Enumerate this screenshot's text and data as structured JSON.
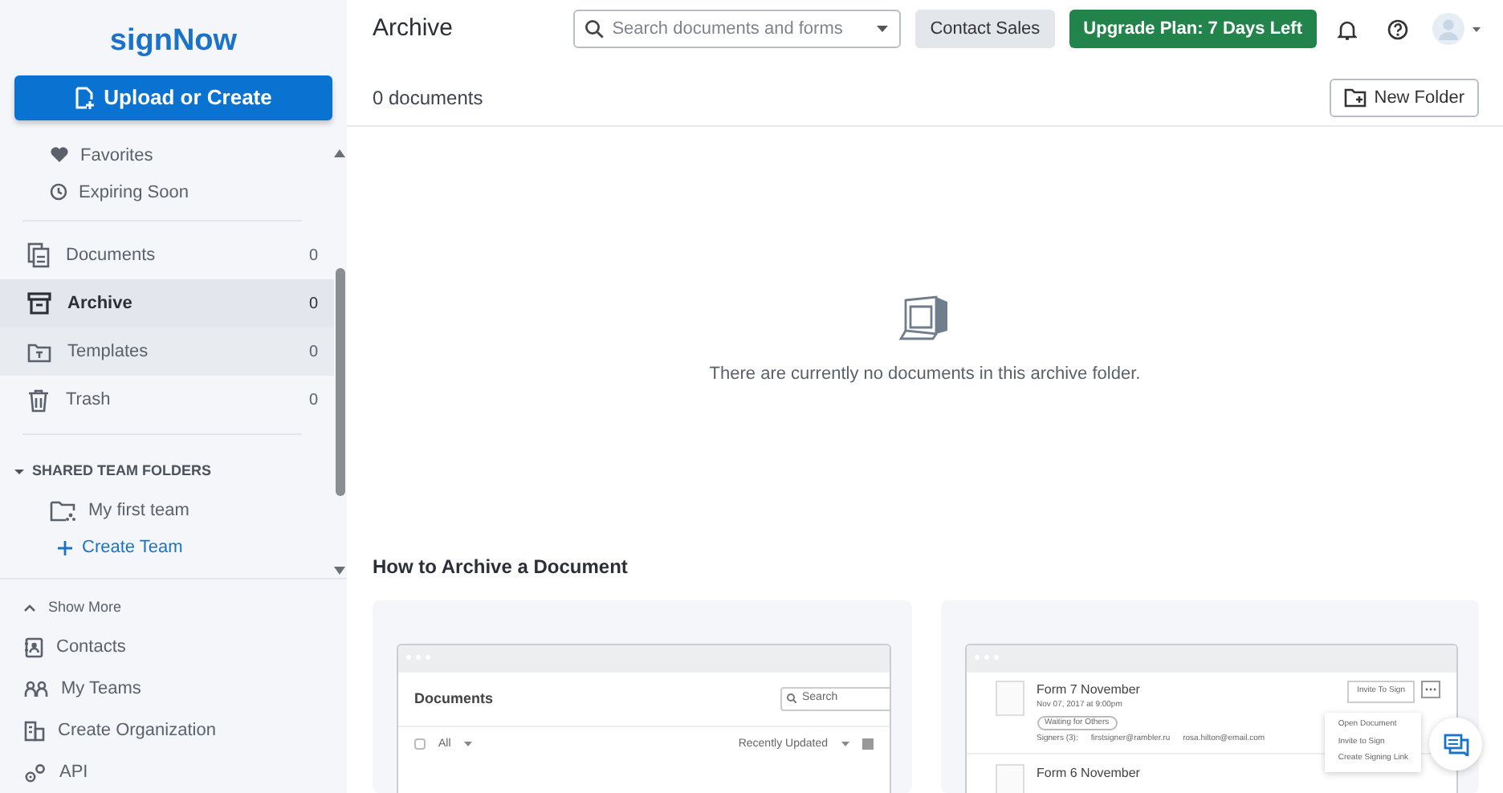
{
  "sidebar": {
    "logo": "signNow",
    "upload_button": "Upload or Create",
    "quick_links": [
      {
        "label": "Favorites"
      },
      {
        "label": "Expiring Soon"
      }
    ],
    "folders": [
      {
        "label": "Documents",
        "count": "0",
        "selected": false,
        "hovered": false
      },
      {
        "label": "Archive",
        "count": "0",
        "selected": true,
        "hovered": false
      },
      {
        "label": "Templates",
        "count": "0",
        "selected": false,
        "hovered": true
      },
      {
        "label": "Trash",
        "count": "0",
        "selected": false,
        "hovered": false
      }
    ],
    "shared_team_folders": {
      "title": "SHARED TEAM FOLDERS",
      "expanded": true,
      "teams": [
        "My first team"
      ],
      "create_link": "Create Team"
    },
    "show_more": "Show More",
    "bottom_links": [
      {
        "label": "Contacts"
      },
      {
        "label": "My Teams"
      },
      {
        "label": "Create Organization"
      },
      {
        "label": "API"
      }
    ]
  },
  "header": {
    "title": "Archive",
    "search": {
      "placeholder": "Search documents and forms"
    },
    "contact_button": "Contact Sales",
    "upgrade_button": "Upgrade Plan: 7 Days Left"
  },
  "toolbar": {
    "count": "0 documents",
    "new_folder_button": "New Folder"
  },
  "empty_state": {
    "message": "There are currently no documents in this archive folder."
  },
  "how_to": {
    "title": "How to Archive a Document",
    "previews": [
      {
        "kind": "list",
        "heading": "Documents",
        "search_placeholder": "Search",
        "select_all_checked": false,
        "filter": "All",
        "sort": "Recently Updated"
      },
      {
        "kind": "detail",
        "rows": [
          {
            "title": "Form 7 November",
            "date": "Nov 07, 2017 at 9:00pm",
            "status": "Waiting for Others",
            "signers": "Signers (3):",
            "emails": [
              "firstsigner@rambler.ru",
              "rosa.hilton@email.com"
            ]
          },
          {
            "title": "Form 6 November"
          }
        ],
        "action_button": "Invite To Sign",
        "menu": [
          "Open Document",
          "Invite to Sign",
          "Create Signing Link"
        ]
      }
    ]
  }
}
